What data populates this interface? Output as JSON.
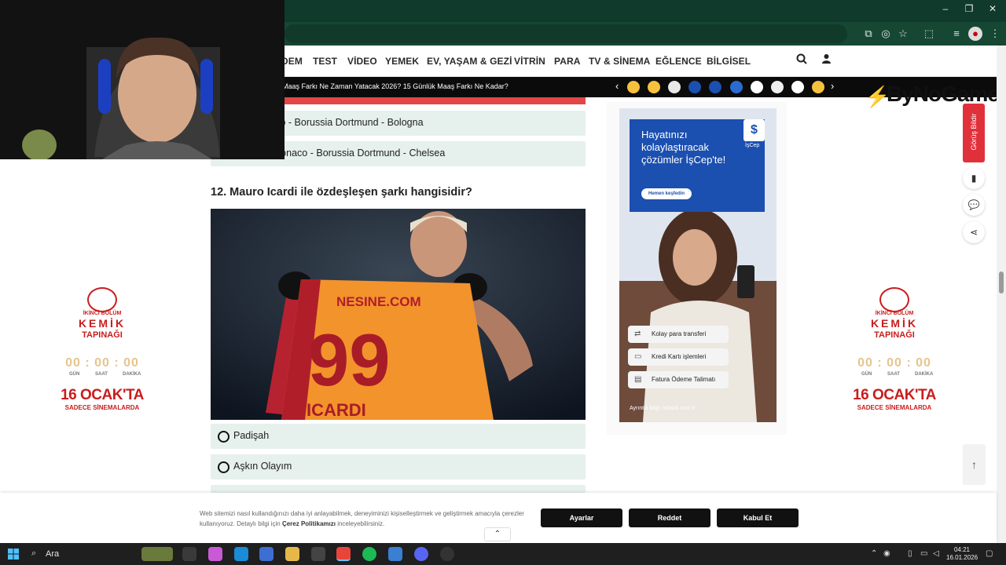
{
  "browser": {
    "window_controls": [
      "–",
      "❐",
      "✕"
    ]
  },
  "site_nav": {
    "items": [
      "DEM",
      "TEST",
      "VİDEO",
      "YEMEK",
      "EV, YAŞAM & GEZİ",
      "VİTRİN",
      "PARA",
      "TV & SİNEMA",
      "EĞLENCE",
      "BİLGİSEL"
    ]
  },
  "news_strip": {
    "headline": "Maaş Farkı Ne Zaman Yatacak 2026? 15 Günlük Maaş Farkı Ne Kadar?"
  },
  "brand": {
    "logo": "ByNoGame"
  },
  "quiz": {
    "prev_answers": [
      "Chelsea - Monaco - Borussia Dortmund - Bologna",
      "Leeds United - Monaco - Borussia Dortmund - Chelsea"
    ],
    "question": "12. Mauro Icardi ile özdeşleşen şarkı hangisidir?",
    "photo": {
      "shirt_sponsor": "NESINE.COM",
      "shirt_number": "99",
      "shirt_name": "ICARDI"
    },
    "options": [
      "Padişah",
      "Aşkın Olayım"
    ]
  },
  "ad": {
    "headline": "Hayatınızı kolaylaştıracak çözümler İşCep'te!",
    "cta": "Hemen keşfedin",
    "badge": "İşCep",
    "features": [
      "Kolay para transferi",
      "Kredi Kartı işlemleri",
      "Fatura Ödeme Talimatı"
    ],
    "footer": "Ayrıntılı bilgi: isbank.com.tr"
  },
  "promo": {
    "title_line1": "İKİNCİ BÖLÜM",
    "title_line2": "KEMİK",
    "title_line3": "TAPINAĞI",
    "timer": "00 : 00 : 00",
    "labels": [
      "GÜN",
      "SAAT",
      "DAKİKA"
    ],
    "date": "16 OCAK'TA",
    "subtitle": "SADECE SİNEMALARDA"
  },
  "floating": {
    "feedback": "Görüş Bildir"
  },
  "cookie": {
    "text_pre": "Web sitemizi nasıl kullandığınızı daha iyi anlayabilmek, deneyiminizi kişiselleştirmek ve geliştirmek amacıyla çerezler kullanıyoruz. Detaylı bilgi için ",
    "link": "Çerez Politikamızı",
    "text_post": " inceleyebilirsiniz.",
    "buttons": [
      "Ayarlar",
      "Reddet",
      "Kabul Et"
    ]
  },
  "taskbar": {
    "search": "Ara",
    "time": "04:21",
    "date": "16.01.2026"
  },
  "colors": {
    "titlebar": "#0f3a2c",
    "toolbar": "#164733",
    "answer_bg": "#e6f0ec",
    "accent_red": "#e24646",
    "ad_blue": "#1b4fb0"
  }
}
